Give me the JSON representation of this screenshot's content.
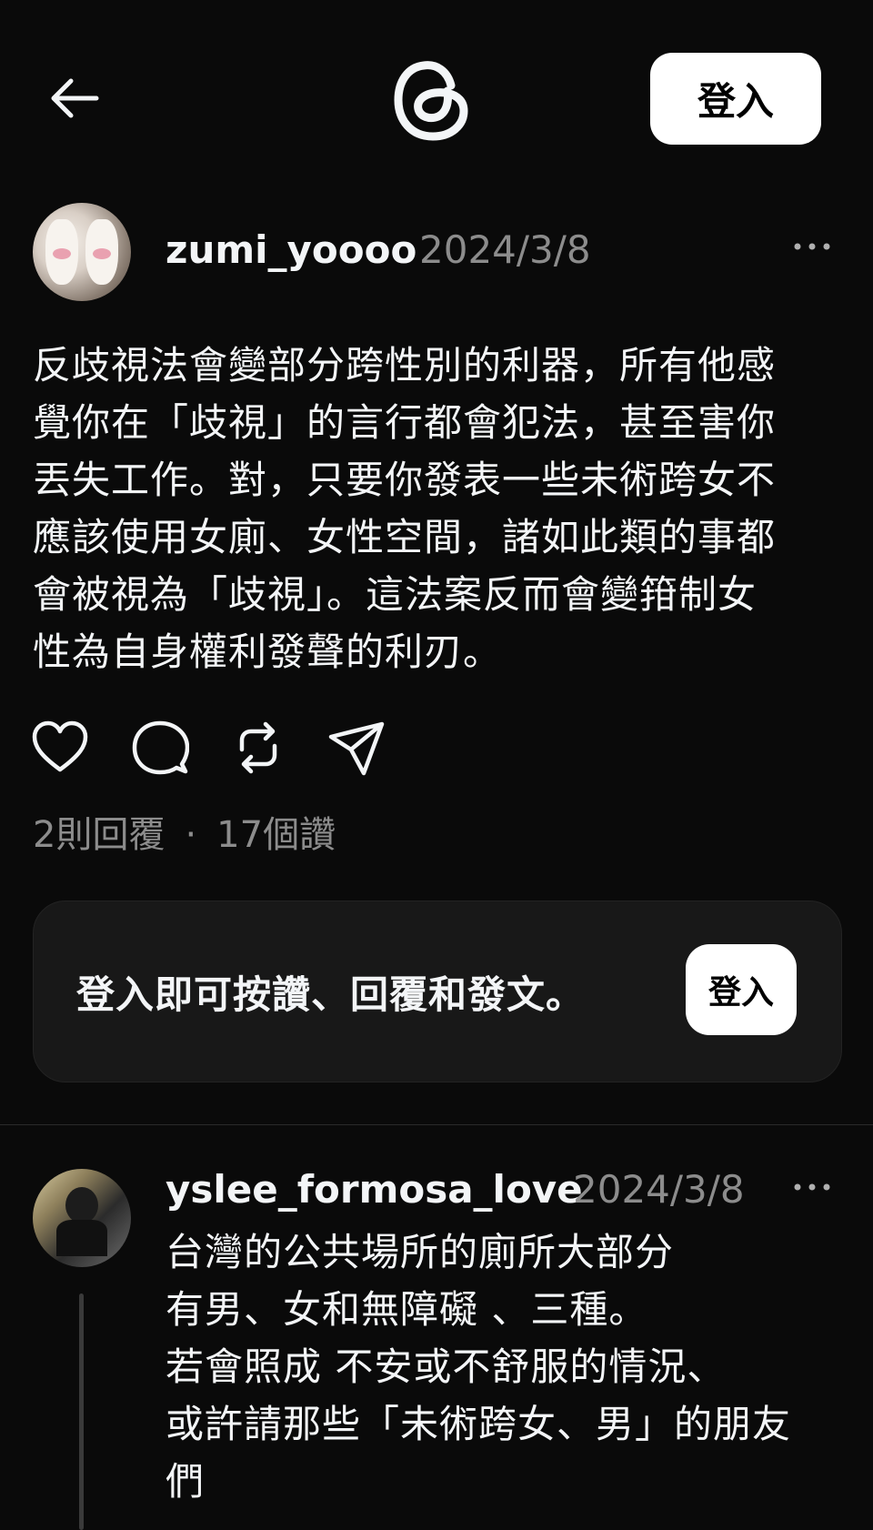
{
  "header": {
    "login_label": "登入"
  },
  "post": {
    "username": "zumi_yoooo",
    "date": "2024/3/8",
    "text": "反歧視法會變部分跨性別的利器，所有他感\n覺你在「歧視」的言行都會犯法，甚至害你\n丟失工作。對，只要你發表一些未術跨女不\n應該使用女廁、女性空間，諸如此類的事都\n會被視為「歧視」。這法案反而會變箝制女\n性為自身權利發聲的利刃。",
    "replies": "2則回覆",
    "separator": "·",
    "likes": "17個讚"
  },
  "login_card": {
    "text": "登入即可按讚、回覆和發文。",
    "button_label": "登入"
  },
  "reply": {
    "username": "yslee_formosa_love",
    "date": "2024/3/8",
    "text": "台灣的公共場所的廁所大部分\n有男、女和無障礙 、三種。\n若會照成 不安或不舒服的情況、\n或許請那些「未術跨女、男」的朋友\n們"
  },
  "icons": {
    "back": "arrow-left-icon",
    "logo": "threads-logo-icon",
    "more": "more-horizontal-icon",
    "like": "heart-icon",
    "comment": "comment-icon",
    "repost": "repost-icon",
    "share": "send-icon"
  },
  "colors": {
    "background": "#0a0a0a",
    "text": "#f3f5f7",
    "muted": "#8c8c8c",
    "card": "#181818"
  }
}
